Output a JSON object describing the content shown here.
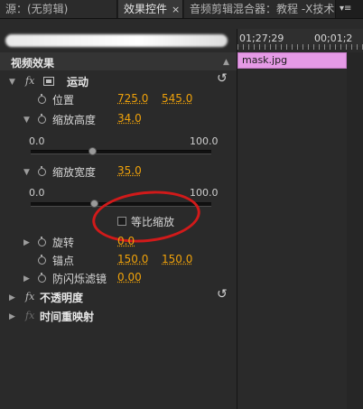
{
  "tabs": [
    {
      "label": "源：(无剪辑)"
    },
    {
      "label": "效果控件",
      "close": "×"
    },
    {
      "label": "音频剪辑混合器：教程 -X技术"
    },
    {
      "menu": "▾≡"
    }
  ],
  "timeline": {
    "timecode_left": "01;27;29",
    "timecode_right": "00;01;2",
    "clip_name": "mask.jpg"
  },
  "section_title": "视频效果",
  "effects": {
    "motion": {
      "label": "运动",
      "position": {
        "label": "位置",
        "x": "725.0",
        "y": "545.0"
      },
      "scale_height": {
        "label": "缩放高度",
        "value": "34.0",
        "min": "0.0",
        "max": "100.0",
        "level": 0.34
      },
      "scale_width": {
        "label": "缩放宽度",
        "value": "35.0",
        "min": "0.0",
        "max": "100.0",
        "level": 0.35
      },
      "uniform_scale": {
        "label": "等比缩放",
        "checked": false
      },
      "rotation": {
        "label": "旋转",
        "value": "0.0"
      },
      "anchor": {
        "label": "锚点",
        "x": "150.0",
        "y": "150.0"
      },
      "anti_flicker": {
        "label": "防闪烁滤镜",
        "value": "0.00"
      }
    },
    "opacity": {
      "label": "不透明度"
    },
    "time_remap": {
      "label": "时间重映射"
    }
  },
  "colors": {
    "accent_value": "#f0a20a",
    "clip": "#e59ae6",
    "annotation": "#d11a1a"
  }
}
